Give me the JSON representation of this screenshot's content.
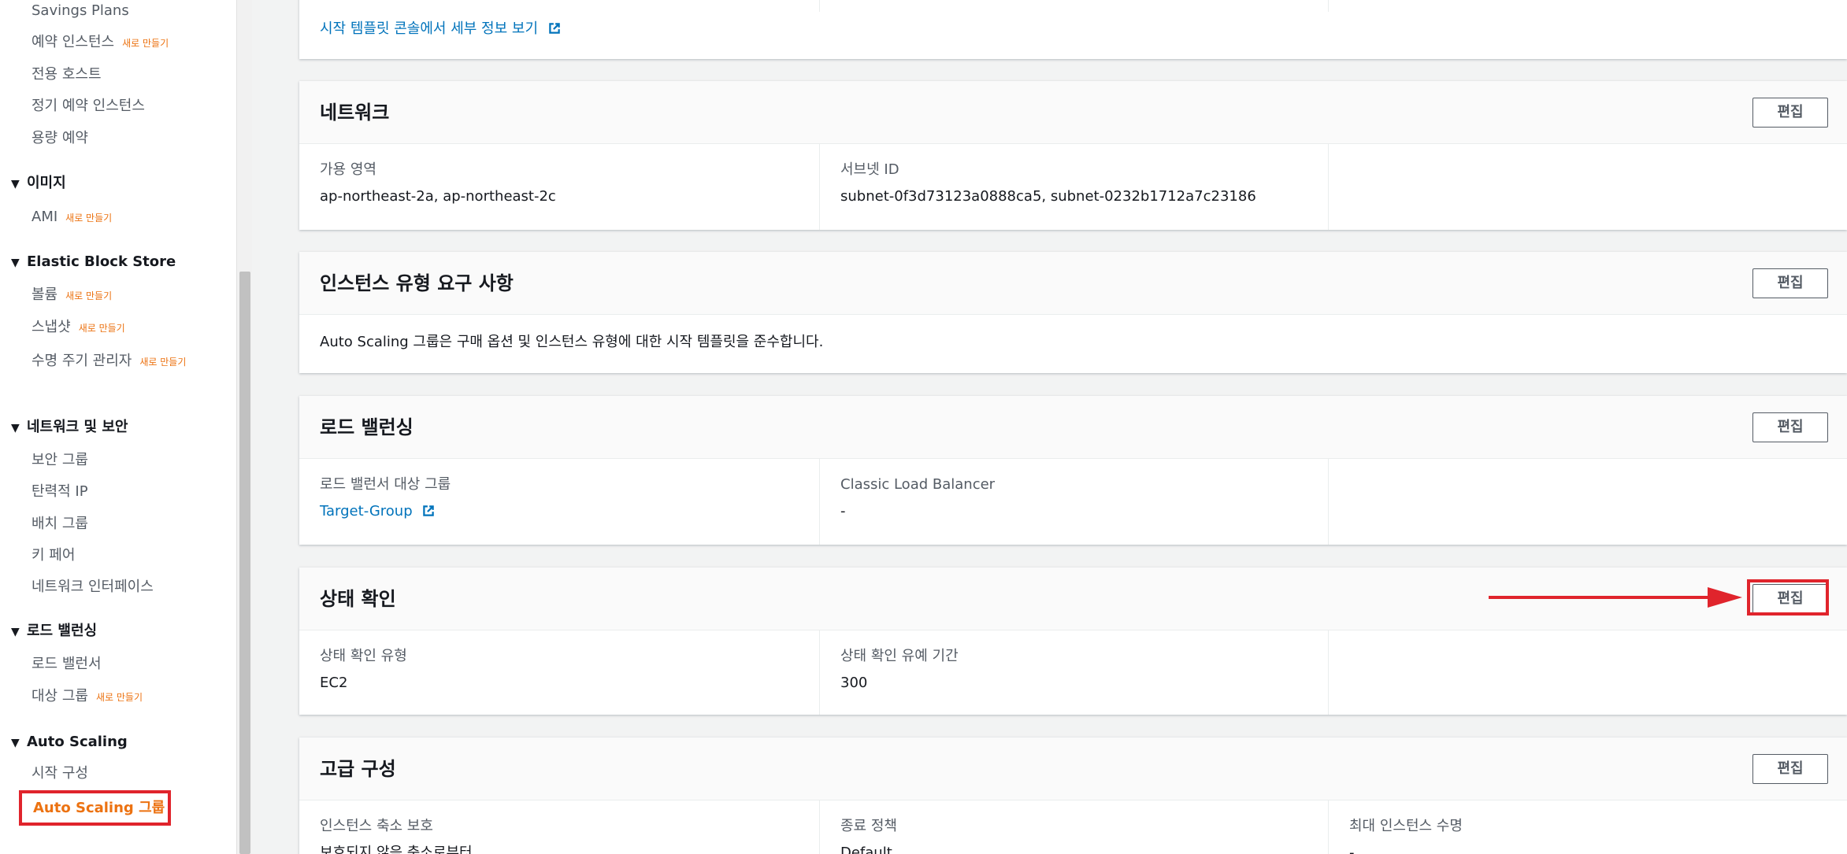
{
  "sidebar": {
    "items": [
      {
        "label": "Savings Plans"
      },
      {
        "label": "예약 인스턴스",
        "badge": "새로 만들기"
      },
      {
        "label": "전용 호스트"
      },
      {
        "label": "정기 예약 인스턴스"
      },
      {
        "label": "용량 예약"
      }
    ],
    "sections": {
      "images": {
        "label": "이미지",
        "items": [
          {
            "label": "AMI",
            "badge": "새로 만들기"
          }
        ]
      },
      "ebs": {
        "label": "Elastic Block Store",
        "items": [
          {
            "label": "볼륨",
            "badge": "새로 만들기"
          },
          {
            "label": "스냅샷",
            "badge": "새로 만들기"
          },
          {
            "label": "수명 주기 관리자",
            "badge": "새로 만들기"
          }
        ]
      },
      "netsec": {
        "label": "네트워크 및 보안",
        "items": [
          {
            "label": "보안 그룹"
          },
          {
            "label": "탄력적 IP"
          },
          {
            "label": "배치 그룹"
          },
          {
            "label": "키 페어"
          },
          {
            "label": "네트워크 인터페이스"
          }
        ]
      },
      "lb": {
        "label": "로드 밸런싱",
        "items": [
          {
            "label": "로드 밸런서"
          },
          {
            "label": "대상 그룹",
            "badge": "새로 만들기"
          }
        ]
      },
      "asg": {
        "label": "Auto Scaling",
        "items": [
          {
            "label": "시작 구성"
          },
          {
            "label": "Auto Scaling 그룹"
          }
        ]
      }
    }
  },
  "main": {
    "launch_template_link": "시작 템플릿 콘솔에서 세부 정보 보기",
    "edit_label": "편집",
    "network": {
      "title": "네트워크",
      "az_label": "가용 영역",
      "az_value": "ap-northeast-2a, ap-northeast-2c",
      "subnet_label": "서브넷 ID",
      "subnet_value": "subnet-0f3d73123a0888ca5, subnet-0232b1712a7c23186"
    },
    "instance_type": {
      "title": "인스턴스 유형 요구 사항",
      "text": "Auto Scaling 그룹은 구매 옵션 및 인스턴스 유형에 대한 시작 템플릿을 준수합니다."
    },
    "load_balancing": {
      "title": "로드 밸런싱",
      "tg_label": "로드 밸런서 대상 그룹",
      "tg_value": "Target-Group",
      "clb_label": "Classic Load Balancer",
      "clb_value": "-"
    },
    "health_check": {
      "title": "상태 확인",
      "type_label": "상태 확인 유형",
      "type_value": "EC2",
      "grace_label": "상태 확인 유예 기간",
      "grace_value": "300"
    },
    "advanced": {
      "title": "고급 구성",
      "scale_in_label": "인스턴스 축소 보호",
      "scale_in_value": "보호되지 않음 축소로부터",
      "term_label": "종료 정책",
      "term_value": "Default",
      "max_life_label": "최대 인스턴스 수명",
      "max_life_value": "-"
    }
  },
  "colors": {
    "accent": "#ec7211",
    "link": "#0073bb",
    "annotation": "#e0242c"
  }
}
